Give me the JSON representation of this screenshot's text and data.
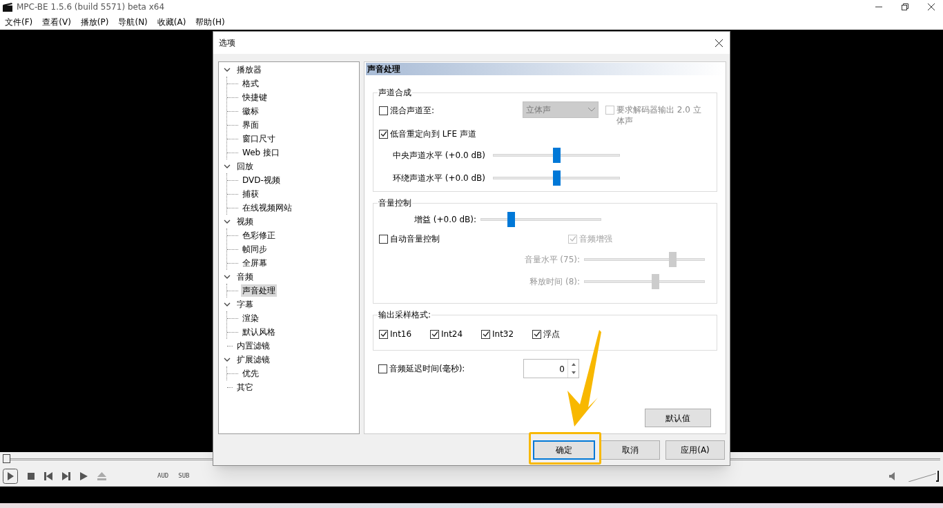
{
  "window": {
    "title": "MPC-BE 1.5.6 (build 5571) beta x64"
  },
  "menu": [
    "文件(F)",
    "查看(V)",
    "播放(P)",
    "导航(N)",
    "收藏(A)",
    "帮助(H)"
  ],
  "dialog": {
    "title": "选项",
    "tree": [
      {
        "label": "播放器",
        "expanded": true,
        "selected": false,
        "children": [
          {
            "label": "格式",
            "selected": false
          },
          {
            "label": "快捷键",
            "selected": false
          },
          {
            "label": "徽标",
            "selected": false
          },
          {
            "label": "界面",
            "selected": false
          },
          {
            "label": "窗口尺寸",
            "selected": false
          },
          {
            "label": "Web 接口",
            "selected": false
          }
        ]
      },
      {
        "label": "回放",
        "expanded": true,
        "selected": false,
        "children": [
          {
            "label": "DVD-视频",
            "selected": false
          },
          {
            "label": "捕获",
            "selected": false
          },
          {
            "label": "在线视频网站",
            "selected": false
          }
        ]
      },
      {
        "label": "视频",
        "expanded": true,
        "selected": false,
        "children": [
          {
            "label": "色彩修正",
            "selected": false
          },
          {
            "label": "帧同步",
            "selected": false
          },
          {
            "label": "全屏幕",
            "selected": false
          }
        ]
      },
      {
        "label": "音频",
        "expanded": true,
        "selected": false,
        "children": [
          {
            "label": "声音处理",
            "selected": true
          }
        ]
      },
      {
        "label": "字幕",
        "expanded": true,
        "selected": false,
        "children": [
          {
            "label": "渲染",
            "selected": false
          },
          {
            "label": "默认风格",
            "selected": false
          }
        ]
      },
      {
        "label": "内置滤镜",
        "selected": false
      },
      {
        "label": "扩展滤镜",
        "expanded": true,
        "selected": false,
        "children": [
          {
            "label": "优先",
            "selected": false
          }
        ]
      },
      {
        "label": "其它",
        "selected": false
      }
    ],
    "page_title": "声音处理",
    "mixing": {
      "title": "声道合成",
      "mix": {
        "label": "混合声道至:",
        "checked": false
      },
      "mix_select": {
        "value": "立体声",
        "disabled": true
      },
      "decoder": {
        "label": "要求解码器输出 2.0 立体声",
        "checked": false,
        "disabled": true
      },
      "bass": {
        "label": "低音重定向到 LFE 声道",
        "checked": true
      },
      "sliders": [
        {
          "label": "中央声道水平 (+0.0 dB)",
          "level": 0.5
        },
        {
          "label": "环绕声道水平 (+0.0 dB)",
          "level": 0.5
        }
      ]
    },
    "volume": {
      "title": "音量控制",
      "gain": {
        "label": "增益 (+0.0 dB):",
        "level": 0.25
      },
      "auto": {
        "label": "自动音量控制",
        "checked": false
      },
      "boost": {
        "label": "音频增强",
        "checked": true,
        "disabled": true
      },
      "sliders": [
        {
          "label": "音量水平 (75):",
          "level": 0.73,
          "disabled": true
        },
        {
          "label": "释放时间 (8):",
          "level": 0.59,
          "disabled": true
        }
      ]
    },
    "output": {
      "title": "输出采样格式:",
      "formats": [
        {
          "label": "Int16",
          "checked": true
        },
        {
          "label": "Int24",
          "checked": true
        },
        {
          "label": "Int32",
          "checked": true
        },
        {
          "label": "浮点",
          "checked": true
        }
      ]
    },
    "delay": {
      "label": "音频延迟时间(毫秒):",
      "checked": false,
      "value": "0"
    },
    "default_button": "默认值",
    "buttons": [
      {
        "label": "确定",
        "focused": true
      },
      {
        "label": "取消",
        "focused": false
      },
      {
        "label": "应用(A)",
        "focused": false
      }
    ]
  },
  "player": {
    "seek": {
      "level": 0
    },
    "labels": [
      "AUD",
      "SUB"
    ],
    "volume": {
      "level": 1
    }
  }
}
